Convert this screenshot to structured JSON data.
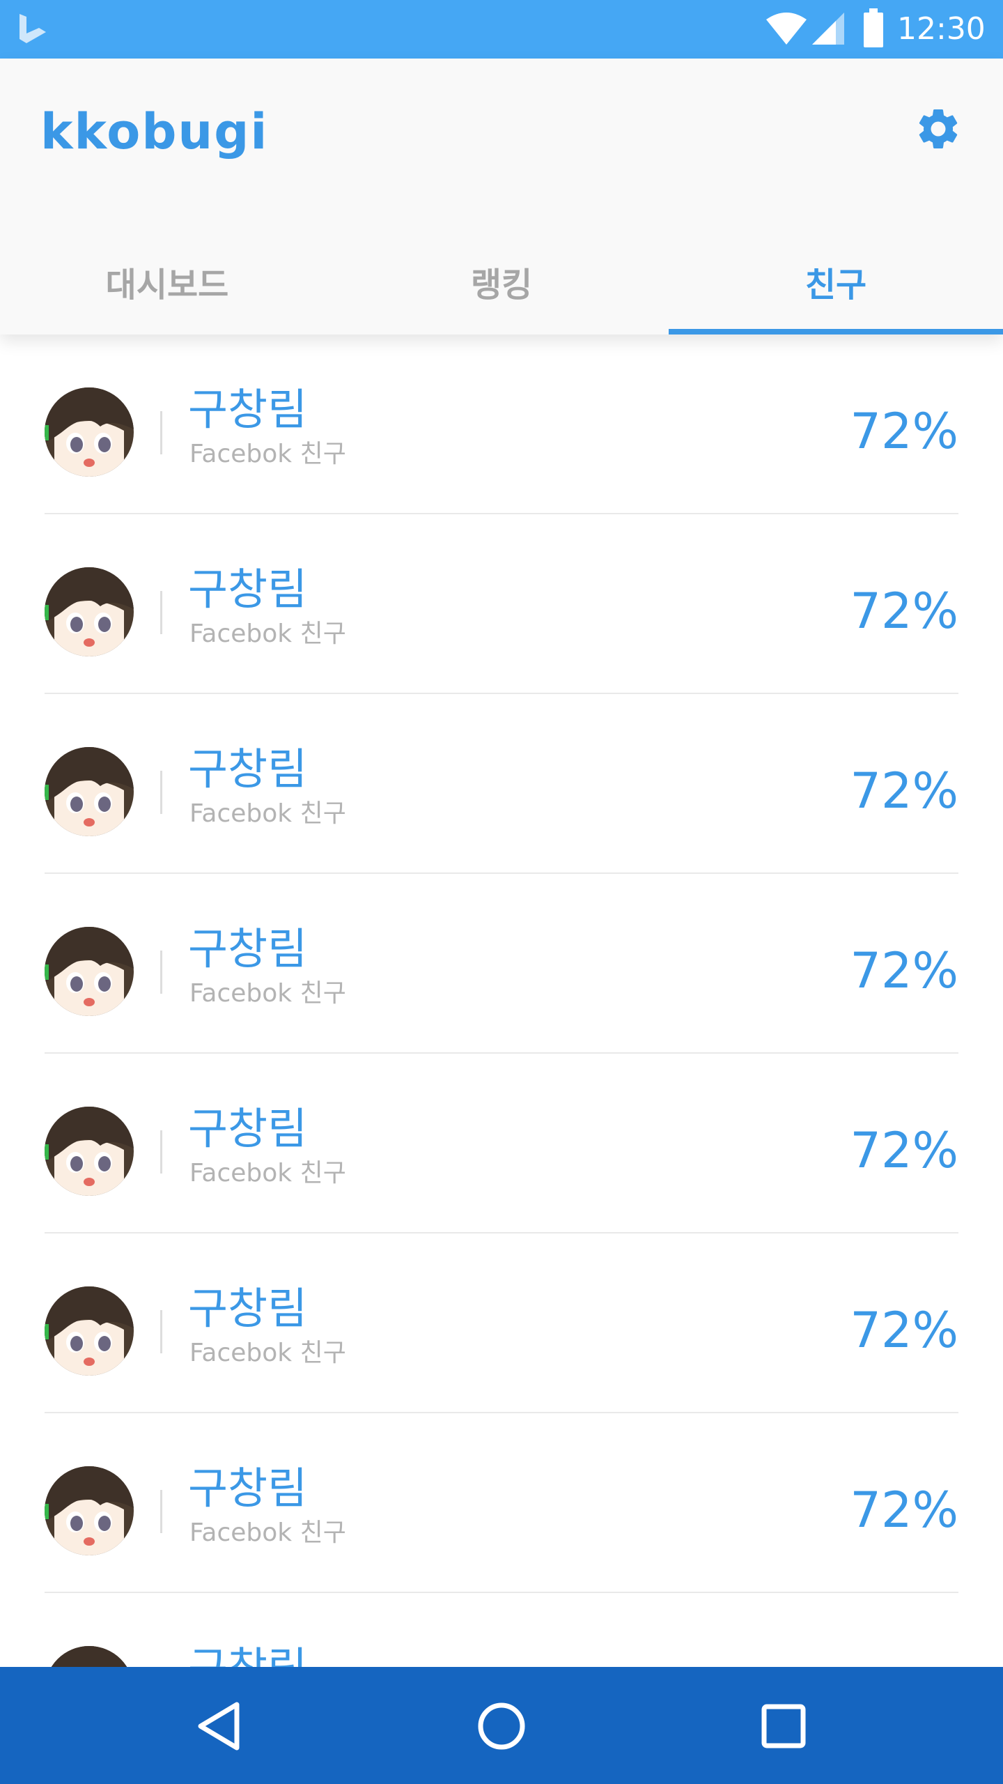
{
  "status_bar": {
    "time": "12:30",
    "icons": [
      "bing-logo-icon",
      "wifi-icon",
      "cell-signal-icon",
      "battery-icon"
    ]
  },
  "app": {
    "title": "kkobugi",
    "settings_icon": "gear-icon"
  },
  "tabs": [
    {
      "label": "대시보드",
      "active": false
    },
    {
      "label": "랭킹",
      "active": false
    },
    {
      "label": "친구",
      "active": true
    }
  ],
  "friends": [
    {
      "name": "구창림",
      "source": "Facebok 친구",
      "percent": "72%"
    },
    {
      "name": "구창림",
      "source": "Facebok 친구",
      "percent": "72%"
    },
    {
      "name": "구창림",
      "source": "Facebok 친구",
      "percent": "72%"
    },
    {
      "name": "구창림",
      "source": "Facebok 친구",
      "percent": "72%"
    },
    {
      "name": "구창림",
      "source": "Facebok 친구",
      "percent": "72%"
    },
    {
      "name": "구창림",
      "source": "Facebok 친구",
      "percent": "72%"
    },
    {
      "name": "구창림",
      "source": "Facebok 친구",
      "percent": "72%"
    },
    {
      "name": "구창림",
      "source": "",
      "percent": ""
    }
  ],
  "nav": {
    "back_icon": "back-triangle-icon",
    "home_icon": "home-circle-icon",
    "recents_icon": "recents-square-icon"
  },
  "colors": {
    "status_bar": "#45a7f4",
    "accent": "#3b98e6",
    "nav_bar": "#1565c0",
    "muted_text": "#b3b3b3"
  }
}
